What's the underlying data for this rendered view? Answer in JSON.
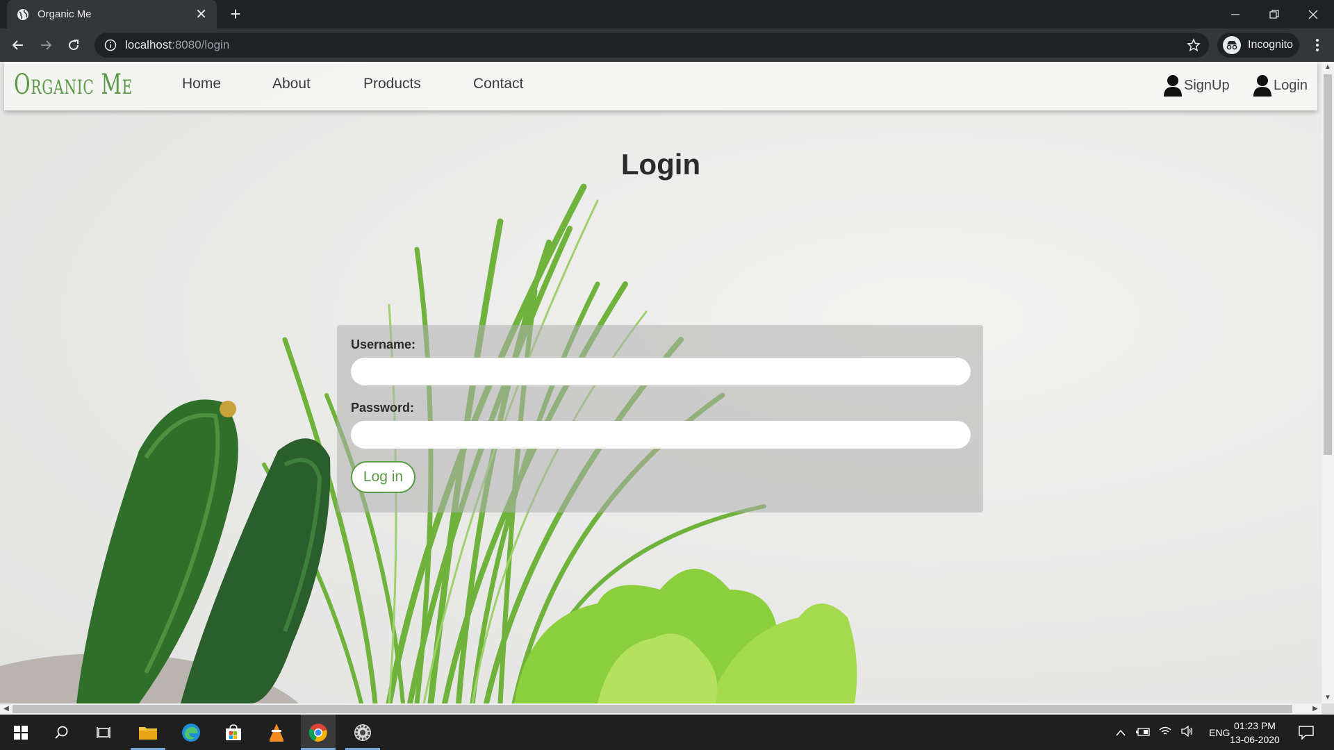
{
  "browser": {
    "tab_title": "Organic Me",
    "tab_close": "✕",
    "new_tab": "+",
    "url_host": "localhost",
    "url_path": ":8080/login",
    "profile_label": "Incognito"
  },
  "site": {
    "brand": "Organic Me",
    "nav": {
      "home": "Home",
      "about": "About",
      "products": "Products",
      "contact": "Contact"
    },
    "auth": {
      "signup": "SignUp",
      "login": "Login"
    }
  },
  "page": {
    "title": "Login",
    "username_label": "Username:",
    "username_value": "",
    "password_label": "Password:",
    "password_value": "",
    "submit_label": "Log in"
  },
  "taskbar": {
    "language": "ENG",
    "time": "01:23 PM",
    "date": "13-06-2020"
  },
  "colors": {
    "brand_green": "#5a9a44",
    "chrome_dark": "#202124",
    "chrome_toolbar": "#35363a"
  }
}
